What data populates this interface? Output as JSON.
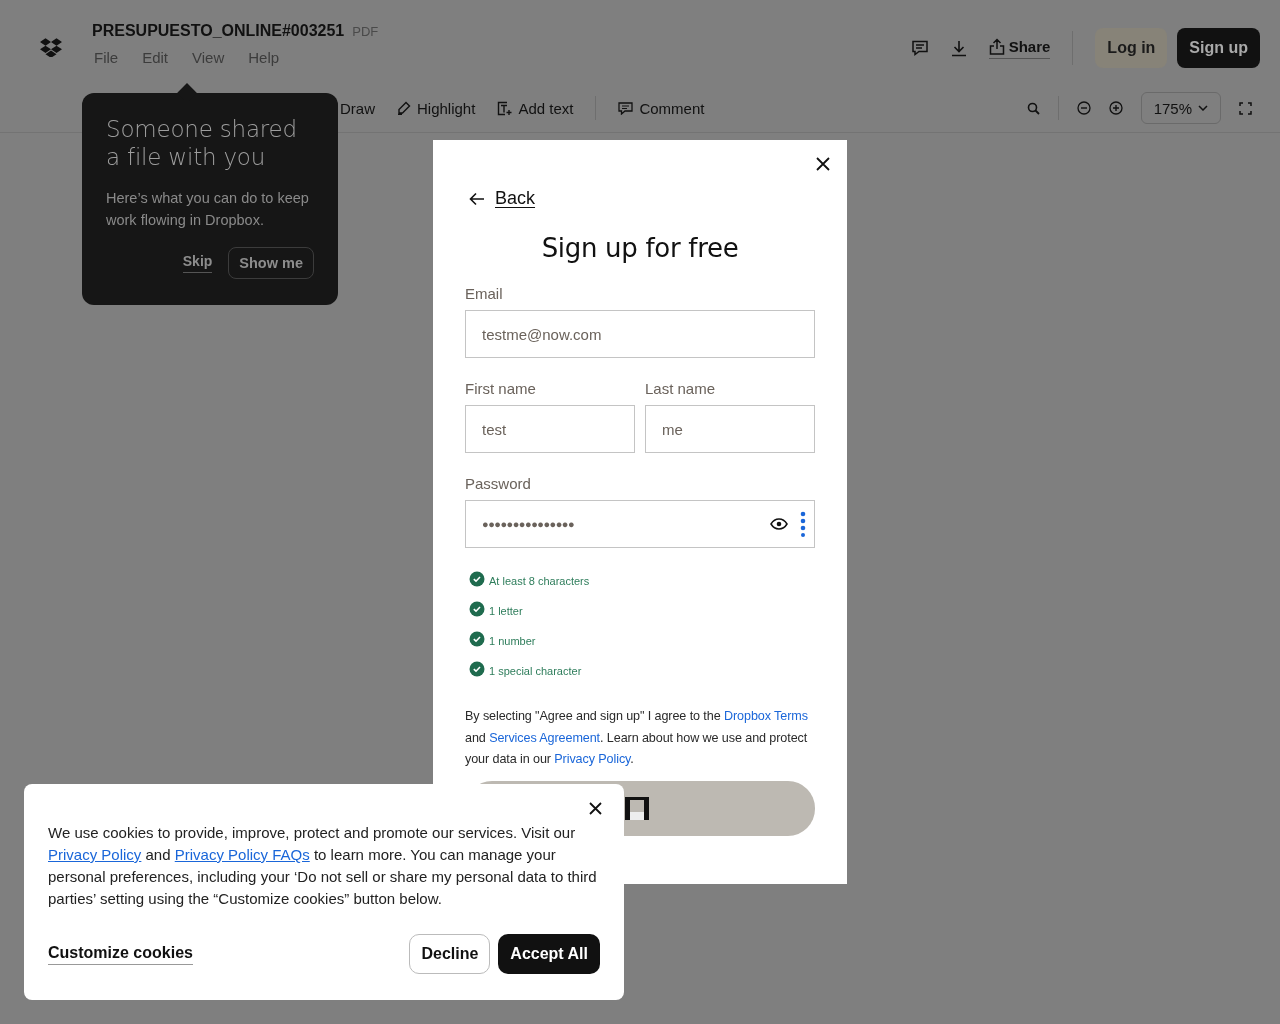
{
  "header": {
    "file_name": "PRESUPUESTO_ONLINE#003251",
    "file_type": "PDF",
    "menu": [
      "File",
      "Edit",
      "View",
      "Help"
    ],
    "share": "Share",
    "login": "Log in",
    "signup": "Sign up"
  },
  "toolbar": {
    "tool_groups": [
      [
        {
          "label": "Draw",
          "kind": "draw"
        },
        {
          "label": "Highlight",
          "kind": "highlight"
        },
        {
          "label": "Add text",
          "kind": "text"
        }
      ],
      [
        {
          "label": "Comment",
          "kind": "comment"
        }
      ]
    ],
    "zoom": "175%"
  },
  "tooltip": {
    "title": "Someone shared a file with you",
    "body": "Here’s what you can do to keep work flowing in Dropbox.",
    "skip": "Skip",
    "show": "Show me"
  },
  "signup_modal": {
    "back": "Back",
    "title": "Sign up for free",
    "email": {
      "label": "Email",
      "value": "testme@now.com"
    },
    "first_name": {
      "label": "First name",
      "value": "test"
    },
    "last_name": {
      "label": "Last name",
      "value": "me"
    },
    "password": {
      "label": "Password",
      "value": "●●●●●●●●●●●●●●●"
    },
    "requirements": [
      {
        "text": "At least 8 characters",
        "met": true
      },
      {
        "text": "1 letter",
        "met": true
      },
      {
        "text": "1 number",
        "met": true
      },
      {
        "text": "1 special character",
        "met": true
      }
    ],
    "legal": [
      {
        "kind": "text",
        "text": "By selecting \"Agree and sign up\" I agree to the "
      },
      {
        "kind": "link",
        "text": "Dropbox Terms"
      },
      {
        "kind": "text",
        "text": " and "
      },
      {
        "kind": "link",
        "text": "Services Agreement"
      },
      {
        "kind": "text",
        "text": ". Learn about how we use and protect your data in our "
      },
      {
        "kind": "link",
        "text": "Privacy Policy"
      },
      {
        "kind": "text",
        "text": "."
      }
    ]
  },
  "cookie_banner": {
    "text": [
      {
        "kind": "text",
        "text": "We use cookies to provide, improve, protect and promote our services. Visit our "
      },
      {
        "kind": "link",
        "text": "Privacy Policy"
      },
      {
        "kind": "text",
        "text": " and "
      },
      {
        "kind": "link",
        "text": "Privacy Policy FAQs"
      },
      {
        "kind": "text",
        "text": " to learn more. You can manage your personal preferences, including your ‘Do not sell or share my personal data to third parties’ setting using the “Customize cookies” button below."
      }
    ],
    "customize": "Customize cookies",
    "decline": "Decline",
    "accept": "Accept All"
  }
}
